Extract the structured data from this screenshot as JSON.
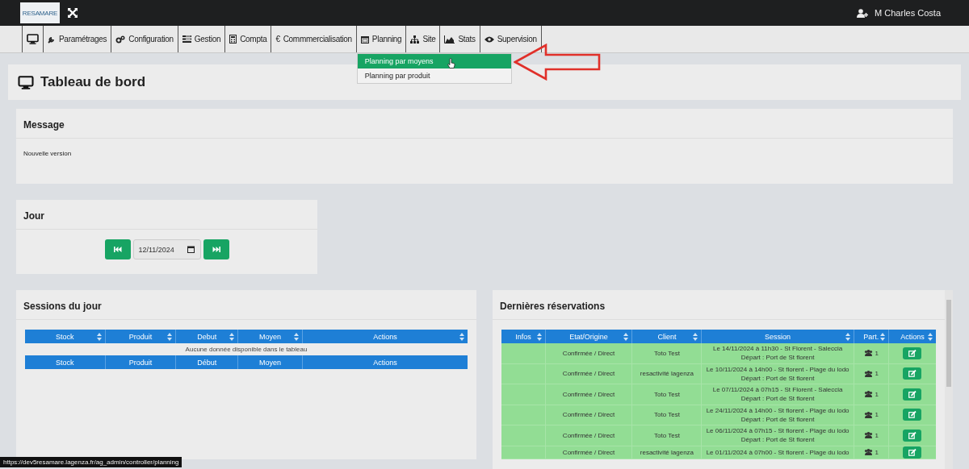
{
  "header": {
    "logo": "RESAMARE",
    "user": "M Charles Costa"
  },
  "nav": [
    {
      "kind": "icon"
    },
    {
      "kind": "icon",
      "label": "Paramétrages"
    },
    {
      "kind": "icon",
      "label": "Configuration"
    },
    {
      "kind": "icon",
      "label": "Gestion"
    },
    {
      "kind": "icon",
      "label": "Compta"
    },
    {
      "kind": "glyph",
      "glyph": "€",
      "label": "Commmercialisation"
    },
    {
      "kind": "icon",
      "label": "Planning",
      "dropdown": [
        {
          "label": "Planning par moyens",
          "selected": true
        },
        {
          "label": "Planning par produit",
          "selected": false
        }
      ]
    },
    {
      "kind": "icon",
      "label": "Site"
    },
    {
      "kind": "icon",
      "label": "Stats"
    },
    {
      "kind": "icon",
      "label": "Supervision"
    }
  ],
  "page_title": "Tableau de bord",
  "message": {
    "title": "Message",
    "text": "Nouvelle version"
  },
  "day": {
    "title": "Jour",
    "date": "12/11/2024"
  },
  "sessions": {
    "title": "Sessions du jour",
    "columns": [
      {
        "label": "Stock",
        "sortable": true
      },
      {
        "label": "Produit",
        "sortable": true
      },
      {
        "label": "Debut",
        "sortable": true
      },
      {
        "label": "Moyen",
        "sortable": true
      },
      {
        "label": "Actions",
        "sortable": true
      }
    ],
    "empty": "Aucune donnée disponible dans le tableau",
    "footer_columns": [
      {
        "label": "Stock",
        "sortable": false
      },
      {
        "label": "Produit",
        "sortable": false
      },
      {
        "label": "Début",
        "sortable": false
      },
      {
        "label": "Moyen",
        "sortable": false
      },
      {
        "label": "Actions",
        "sortable": false
      }
    ]
  },
  "reservations": {
    "title": "Dernières réservations",
    "columns": [
      {
        "label": "Infos",
        "sortable": true
      },
      {
        "label": "Etat/Origine",
        "sortable": true
      },
      {
        "label": "Client",
        "sortable": true
      },
      {
        "label": "Session",
        "sortable": true
      },
      {
        "label": "Part.",
        "sortable": true
      },
      {
        "label": "Actions",
        "sortable": true
      }
    ],
    "rows": [
      {
        "etat": "Confirmée / Direct",
        "client": "Toto Test",
        "session": [
          "Le 14/11/2024 à 11h30 - St Florent - Saleccia",
          "Départ : Port de St florent"
        ],
        "part": "1"
      },
      {
        "etat": "Confirmée / Direct",
        "client": "resactivité lagenza",
        "session": [
          "Le 10/11/2024 à 14h00 - St florent - Plage du lodo",
          "Départ : Port de St florent"
        ],
        "part": "1"
      },
      {
        "etat": "Confirmée / Direct",
        "client": "Toto Test",
        "session": [
          "Le 07/11/2024 à 07h15 - St Florent - Saleccia",
          "Départ : Port de St florent"
        ],
        "part": "1"
      },
      {
        "etat": "Confirmée / Direct",
        "client": "Toto Test",
        "session": [
          "Le 24/11/2024 à 14h00 - St florent - Plage du lodo",
          "Départ : Port de St florent"
        ],
        "part": "1"
      },
      {
        "etat": "Confirmée / Direct",
        "client": "Toto Test",
        "session": [
          "Le 06/11/2024 à 07h15 - St florent - Plage du lodo",
          "Départ : Port de St florent"
        ],
        "part": "1"
      },
      {
        "etat": "Confirmée / Direct",
        "client": "resactivité lagenza",
        "session": [
          "Le 01/11/2024 à 07h00 - St florent - Plage du lodo"
        ],
        "part": "1"
      }
    ]
  },
  "status_url": "https://dev5resamare.lagenza.fr/ag_admin/controller/planning"
}
